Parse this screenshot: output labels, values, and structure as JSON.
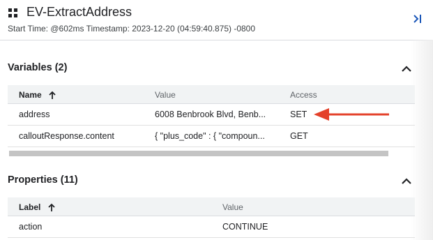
{
  "header": {
    "title": "EV-ExtractAddress",
    "subtitle": "Start Time: @602ms Timestamp: 2023-12-20 (04:59:40.875) -0800",
    "icon": "apps-grid-icon",
    "collapse_icon": "collapse-right-icon"
  },
  "variables": {
    "title": "Variables (2)",
    "columns": {
      "name": "Name",
      "value": "Value",
      "access": "Access"
    },
    "rows": [
      {
        "name": "address",
        "value": "6008 Benbrook Blvd, Benb...",
        "access": "SET"
      },
      {
        "name": "calloutResponse.content",
        "value": "{ \"plus_code\" : { \"compoun...",
        "access": "GET"
      }
    ]
  },
  "properties": {
    "title": "Properties (11)",
    "columns": {
      "label": "Label",
      "value": "Value"
    },
    "rows": [
      {
        "label": "action",
        "value": "CONTINUE"
      }
    ]
  },
  "colors": {
    "accent": "#1a56b8",
    "annotation_arrow": "#e4412a"
  }
}
